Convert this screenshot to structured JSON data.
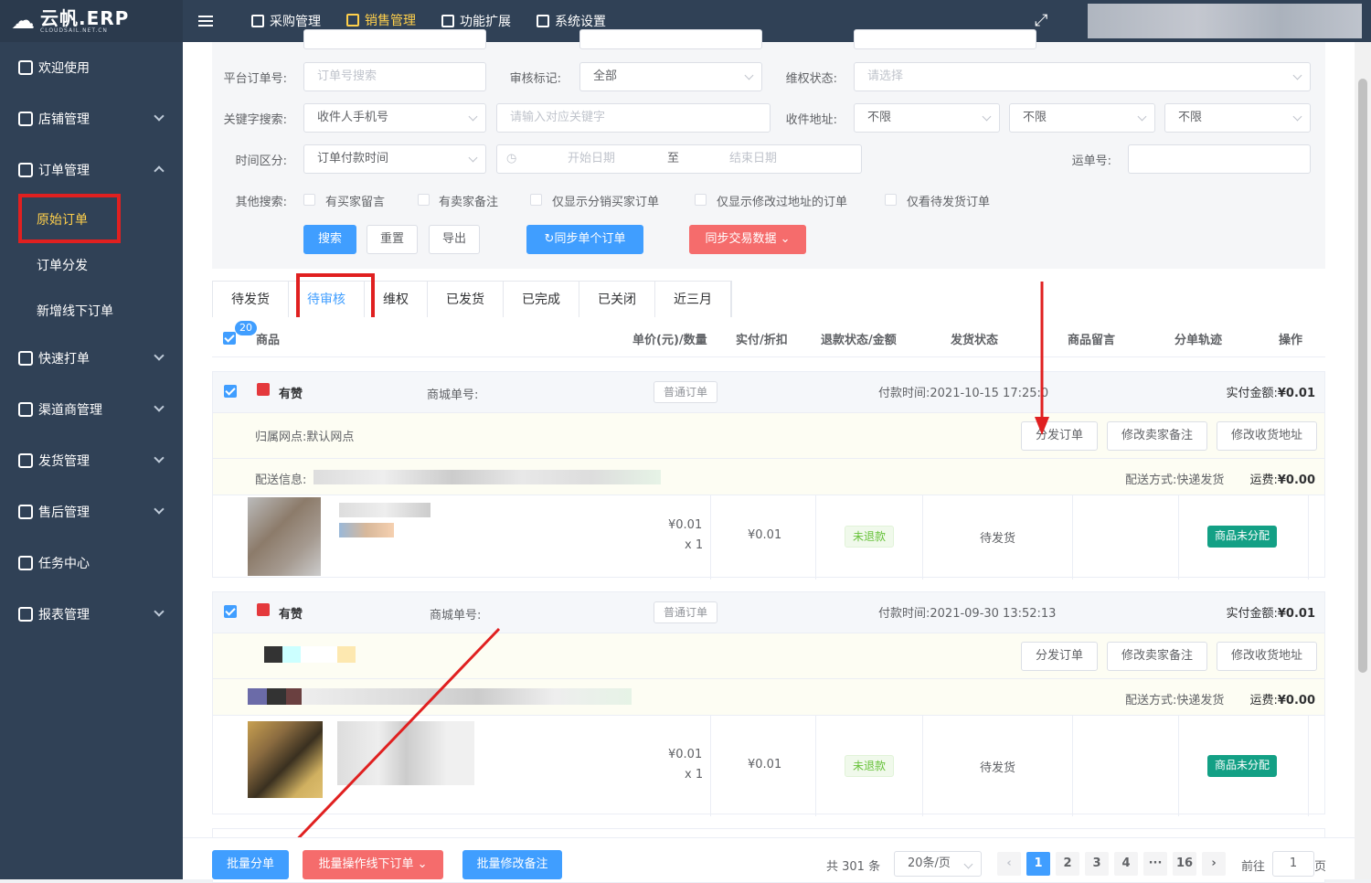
{
  "app": {
    "logo_text": "云帆.ERP",
    "logo_sub": "CLOUDSAIL.NET.CN"
  },
  "sidebar": {
    "items": [
      {
        "label": "欢迎使用"
      },
      {
        "label": "店铺管理"
      },
      {
        "label": "订单管理"
      },
      {
        "label": "快速打单"
      },
      {
        "label": "渠道商管理"
      },
      {
        "label": "发货管理"
      },
      {
        "label": "售后管理"
      },
      {
        "label": "任务中心"
      },
      {
        "label": "报表管理"
      }
    ],
    "sub_items": [
      {
        "label": "原始订单"
      },
      {
        "label": "订单分发"
      },
      {
        "label": "新增线下订单"
      }
    ]
  },
  "topnav": [
    {
      "label": "采购管理"
    },
    {
      "label": "销售管理"
    },
    {
      "label": "功能扩展"
    },
    {
      "label": "系统设置"
    }
  ],
  "filters": {
    "platform_order_label": "平台订单号:",
    "platform_order_placeholder": "订单号搜索",
    "audit_label": "审核标记:",
    "audit_value": "全部",
    "rights_label": "维权状态:",
    "rights_placeholder": "请选择",
    "keyword_label": "关键字搜索:",
    "keyword_type": "收件人手机号",
    "keyword_placeholder": "请输入对应关键字",
    "address_label": "收件地址:",
    "address_values": [
      "不限",
      "不限",
      "不限"
    ],
    "time_label": "时间区分:",
    "time_type": "订单付款时间",
    "start_placeholder": "开始日期",
    "date_sep": "至",
    "end_placeholder": "结束日期",
    "waybill_label": "运单号:",
    "other_label": "其他搜索:",
    "checkboxes": [
      "有买家留言",
      "有卖家备注",
      "仅显示分销买家订单",
      "仅显示修改过地址的订单",
      "仅看待发货订单"
    ],
    "btn_search": "搜索",
    "btn_reset": "重置",
    "btn_export": "导出",
    "btn_sync_single": "同步单个订单",
    "btn_sync_trade": "同步交易数据"
  },
  "tabs": [
    "待发货",
    "待审核",
    "维权",
    "已发货",
    "已完成",
    "已关闭",
    "近三月"
  ],
  "table_head": {
    "badge": "20",
    "cols": [
      "商品",
      "单价(元)/数量",
      "实付/折扣",
      "退款状态/金额",
      "发货状态",
      "商品留言",
      "分单轨迹",
      "操作"
    ]
  },
  "orders": [
    {
      "shop": "有赞",
      "mall_no_label": "商城单号:",
      "type_tag": "普通订单",
      "pay_time": "付款时间:2021-10-15 17:25:0",
      "paid_label": "实付金额:",
      "paid_value": "¥0.01",
      "branch": "归属网点:默认网点",
      "btn_split": "分发订单",
      "btn_remark": "修改卖家备注",
      "btn_addr": "修改收货地址",
      "delivery_info_label": "配送信息:",
      "ship_method": "配送方式:快递发货",
      "freight_label": "运费:",
      "freight_value": "¥0.00",
      "price": "¥0.01",
      "qty": "x 1",
      "paid": "¥0.01",
      "refund": "未退款",
      "ship_status": "待发货",
      "alloc": "商品未分配"
    },
    {
      "shop": "有赞",
      "mall_no_label": "商城单号:",
      "type_tag": "普通订单",
      "pay_time": "付款时间:2021-09-30 13:52:13",
      "paid_label": "实付金额:",
      "paid_value": "¥0.01",
      "btn_split": "分发订单",
      "btn_remark": "修改卖家备注",
      "btn_addr": "修改收货地址",
      "ship_method": "配送方式:快递发货",
      "freight_label": "运费:",
      "freight_value": "¥0.00",
      "price": "¥0.01",
      "qty": "x 1",
      "paid": "¥0.01",
      "refund": "未退款",
      "ship_status": "待发货",
      "alloc": "商品未分配"
    }
  ],
  "footer": {
    "batch_split": "批量分单",
    "batch_offline": "批量操作线下订单",
    "batch_remark": "批量修改备注",
    "total": "共 301 条",
    "page_size": "20条/页",
    "pages": [
      "1",
      "2",
      "3",
      "4",
      "···",
      "16"
    ],
    "goto_label": "前往",
    "goto_value": "1",
    "page_unit": "页"
  },
  "colors": {
    "sidebar": "#304156",
    "accent": "#409eff",
    "danger": "#f56c6c",
    "highlight": "#e02020"
  }
}
